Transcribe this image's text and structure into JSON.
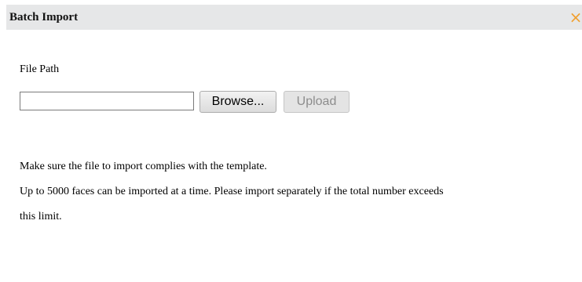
{
  "dialog": {
    "title": "Batch Import",
    "close_symbol": "×",
    "close_icon": "close-icon",
    "accent_color": "#f0a030",
    "title_bar_color": "#e6e7e8"
  },
  "form": {
    "file_path_label": "File Path",
    "file_path_value": "",
    "browse_label": "Browse...",
    "upload_label": "Upload",
    "upload_state": "disabled"
  },
  "info": {
    "line1": "Make sure the file to import complies with the template.",
    "line2": "Up to 5000 faces can be imported at a time. Please import separately if the total number exceeds",
    "line3": "this limit."
  }
}
